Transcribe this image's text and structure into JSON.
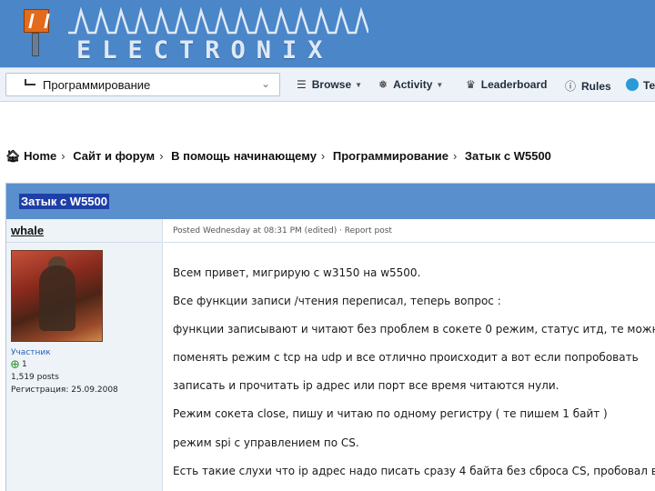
{
  "header": {
    "logo_icon": "electronix-logo-icon",
    "brand": "ELECTRONIX"
  },
  "navbar": {
    "jump_value": "Программирование",
    "items": [
      {
        "label": "Browse",
        "icon": "list-icon",
        "dropdown": true
      },
      {
        "label": "Activity",
        "icon": "megaphone-icon",
        "dropdown": true
      },
      {
        "label": "Leaderboard",
        "icon": "trophy-icon",
        "dropdown": false
      },
      {
        "label": "Rules",
        "icon": "info-icon",
        "dropdown": false
      },
      {
        "label": "Te",
        "icon": "telegram-icon",
        "dropdown": false
      }
    ]
  },
  "breadcrumb": [
    "Home",
    "Сайт и форум",
    "В помощь начинающему",
    "Программирование",
    "Затык с W5500"
  ],
  "post": {
    "title": "Затык с W5500",
    "author": {
      "name": "whale",
      "role": "Участник",
      "reputation": "1",
      "posts": "1,519 posts",
      "registered": "Регистрация: 25.09.2008"
    },
    "meta": "Posted Wednesday at 08:31 PM (edited) · Report post",
    "lines": [
      "Всем привет, мигрирую с w3150 на w5500.",
      "Все функции записи /чтения переписал, теперь вопрос :",
      "функции записывают и читают без проблем в сокете 0 режим, статус итд, те можно",
      "поменять режим с tcp на udp и все отлично происходит а вот если попробовать",
      "записать и прочитать ip адрес или порт все время читаются нули.",
      "Режим сокета close, пишу и читаю по одному регистру ( те пишем  1 байт )",
      "режим spi с управлением по CS.",
      "Есть такие слухи что ip адрес надо писать сразу 4 байта без сброса CS, пробовал в"
    ]
  },
  "colors": {
    "header_bg": "#4a86c8",
    "title_bar": "#5a8fcd",
    "selection": "#1e3fa8",
    "author_bg": "#eef3f8",
    "role_link": "#2a5db8"
  }
}
